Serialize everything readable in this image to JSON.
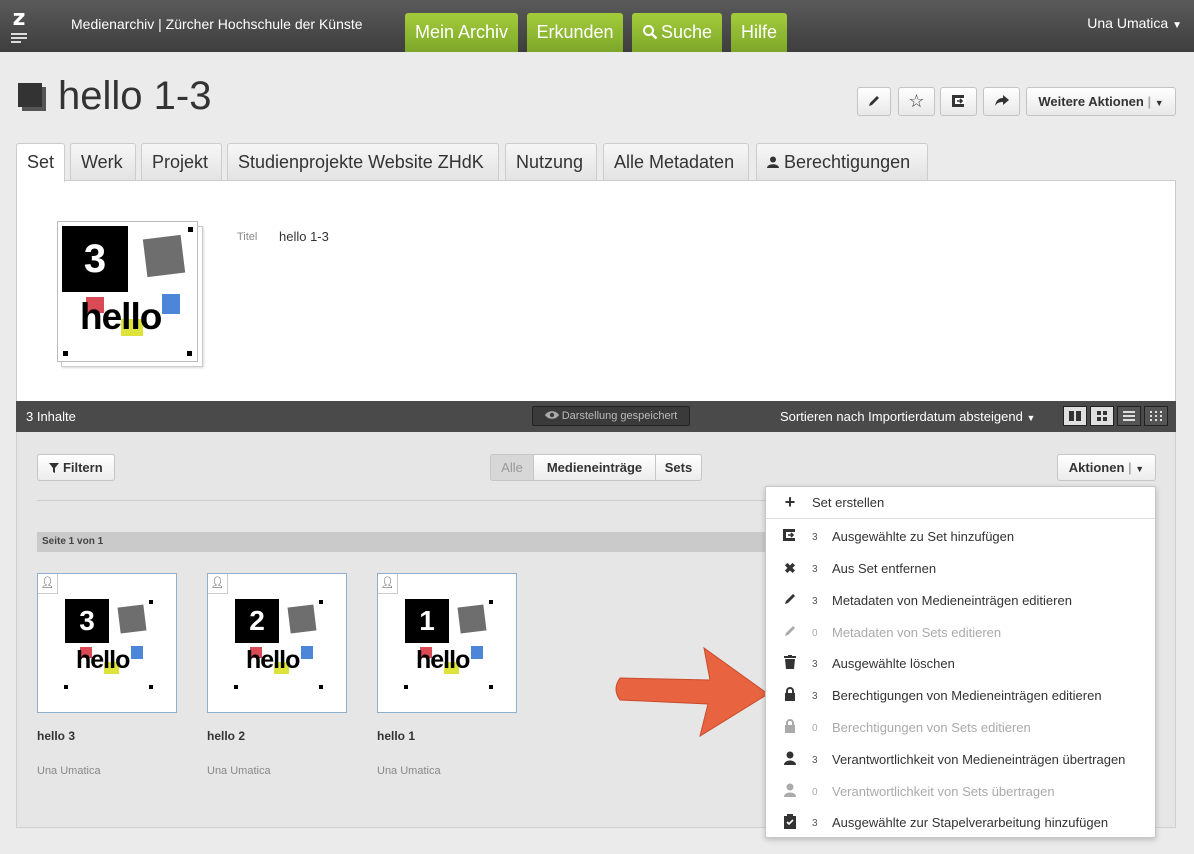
{
  "topbar": {
    "app_title": "Medienarchiv | Zürcher Hochschule der Künste",
    "nav": [
      "Mein Archiv",
      "Erkunden",
      "Suche",
      "Hilfe"
    ],
    "user": "Una Umatica"
  },
  "header": {
    "title": "hello 1-3",
    "more_actions": "Weitere Aktionen"
  },
  "tabs": [
    "Set",
    "Werk",
    "Projekt",
    "Studienprojekte Website ZHdK",
    "Nutzung",
    "Alle Metadaten",
    "Berechtigungen"
  ],
  "set_panel": {
    "thumb_number": "3",
    "thumb_word": "hello",
    "meta_label": "Titel",
    "meta_value": "hello 1-3"
  },
  "content_bar": {
    "count_label": "3 Inhalte",
    "saved_label": "Darstellung gespeichert",
    "sort_label": "Sortieren nach Importierdatum absteigend"
  },
  "toolbar": {
    "filter": "Filtern",
    "type_filters": [
      "Alle",
      "Medieneinträge",
      "Sets"
    ],
    "actions": "Aktionen"
  },
  "page_label": "Seite 1 von 1",
  "items": [
    {
      "number": "3",
      "word": "hello",
      "title": "hello 3",
      "author": "Una Umatica"
    },
    {
      "number": "2",
      "word": "hello",
      "title": "hello 2",
      "author": "Una Umatica"
    },
    {
      "number": "1",
      "word": "hello",
      "title": "hello 1",
      "author": "Una Umatica"
    }
  ],
  "menu": {
    "create_set": "Set erstellen",
    "items": [
      {
        "icon": "add-to-set-icon",
        "count": "3",
        "label": "Ausgewählte zu Set hinzufügen",
        "enabled": true
      },
      {
        "icon": "remove-icon",
        "count": "3",
        "label": "Aus Set entfernen",
        "enabled": true
      },
      {
        "icon": "pencil-icon",
        "count": "3",
        "label": "Metadaten von Medieneinträgen editieren",
        "enabled": true
      },
      {
        "icon": "pencil-icon",
        "count": "0",
        "label": "Metadaten von Sets editieren",
        "enabled": false
      },
      {
        "icon": "trash-icon",
        "count": "3",
        "label": "Ausgewählte löschen",
        "enabled": true
      },
      {
        "icon": "lock-icon",
        "count": "3",
        "label": "Berechtigungen von Medieneinträgen editieren",
        "enabled": true
      },
      {
        "icon": "lock-icon",
        "count": "0",
        "label": "Berechtigungen von Sets editieren",
        "enabled": false
      },
      {
        "icon": "user-icon",
        "count": "3",
        "label": "Verantwortlichkeit von Medieneinträgen übertragen",
        "enabled": true
      },
      {
        "icon": "user-icon",
        "count": "0",
        "label": "Verantwortlichkeit von Sets übertragen",
        "enabled": false
      },
      {
        "icon": "clipboard-icon",
        "count": "3",
        "label": "Ausgewählte zur Stapelverarbeitung hinzufügen",
        "enabled": true
      }
    ]
  },
  "colors": {
    "nav_green": "#8db534",
    "arrow": "#e8633f",
    "dark_bar": "#4a4a4a"
  }
}
